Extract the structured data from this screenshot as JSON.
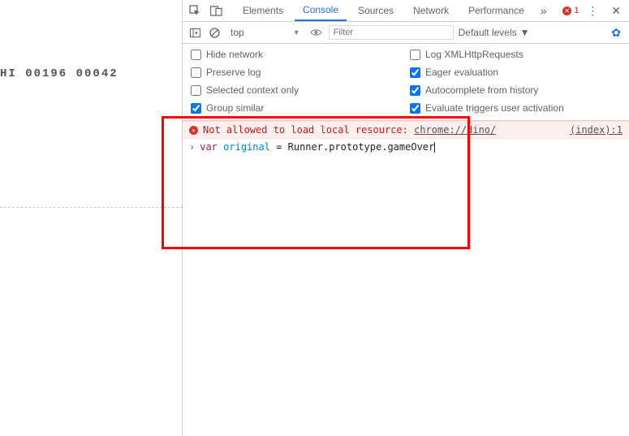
{
  "game": {
    "score_text": "HI 00196 00042"
  },
  "tabs": {
    "elements": "Elements",
    "console": "Console",
    "sources": "Sources",
    "network": "Network",
    "performance": "Performance"
  },
  "error_count": "1",
  "context": {
    "selected": "top"
  },
  "filter": {
    "placeholder": "Filter"
  },
  "levels": {
    "label": "Default levels"
  },
  "settings": {
    "hide_network": {
      "label": "Hide network",
      "checked": false
    },
    "log_xhr": {
      "label": "Log XMLHttpRequests",
      "checked": false
    },
    "preserve_log": {
      "label": "Preserve log",
      "checked": false
    },
    "eager_eval": {
      "label": "Eager evaluation",
      "checked": true
    },
    "selected_ctx": {
      "label": "Selected context only",
      "checked": false
    },
    "autocomplete_hist": {
      "label": "Autocomplete from history",
      "checked": true
    },
    "group_similar": {
      "label": "Group similar",
      "checked": true
    },
    "eval_activation": {
      "label": "Evaluate triggers user activation",
      "checked": true
    }
  },
  "error_line": {
    "prefix": "Not allowed to load local resource: ",
    "url": "chrome://dino/",
    "source": "(index):1"
  },
  "prompt": {
    "kw": "var",
    "ident": " original",
    "rest": " = Runner.prototype.gameOver"
  }
}
